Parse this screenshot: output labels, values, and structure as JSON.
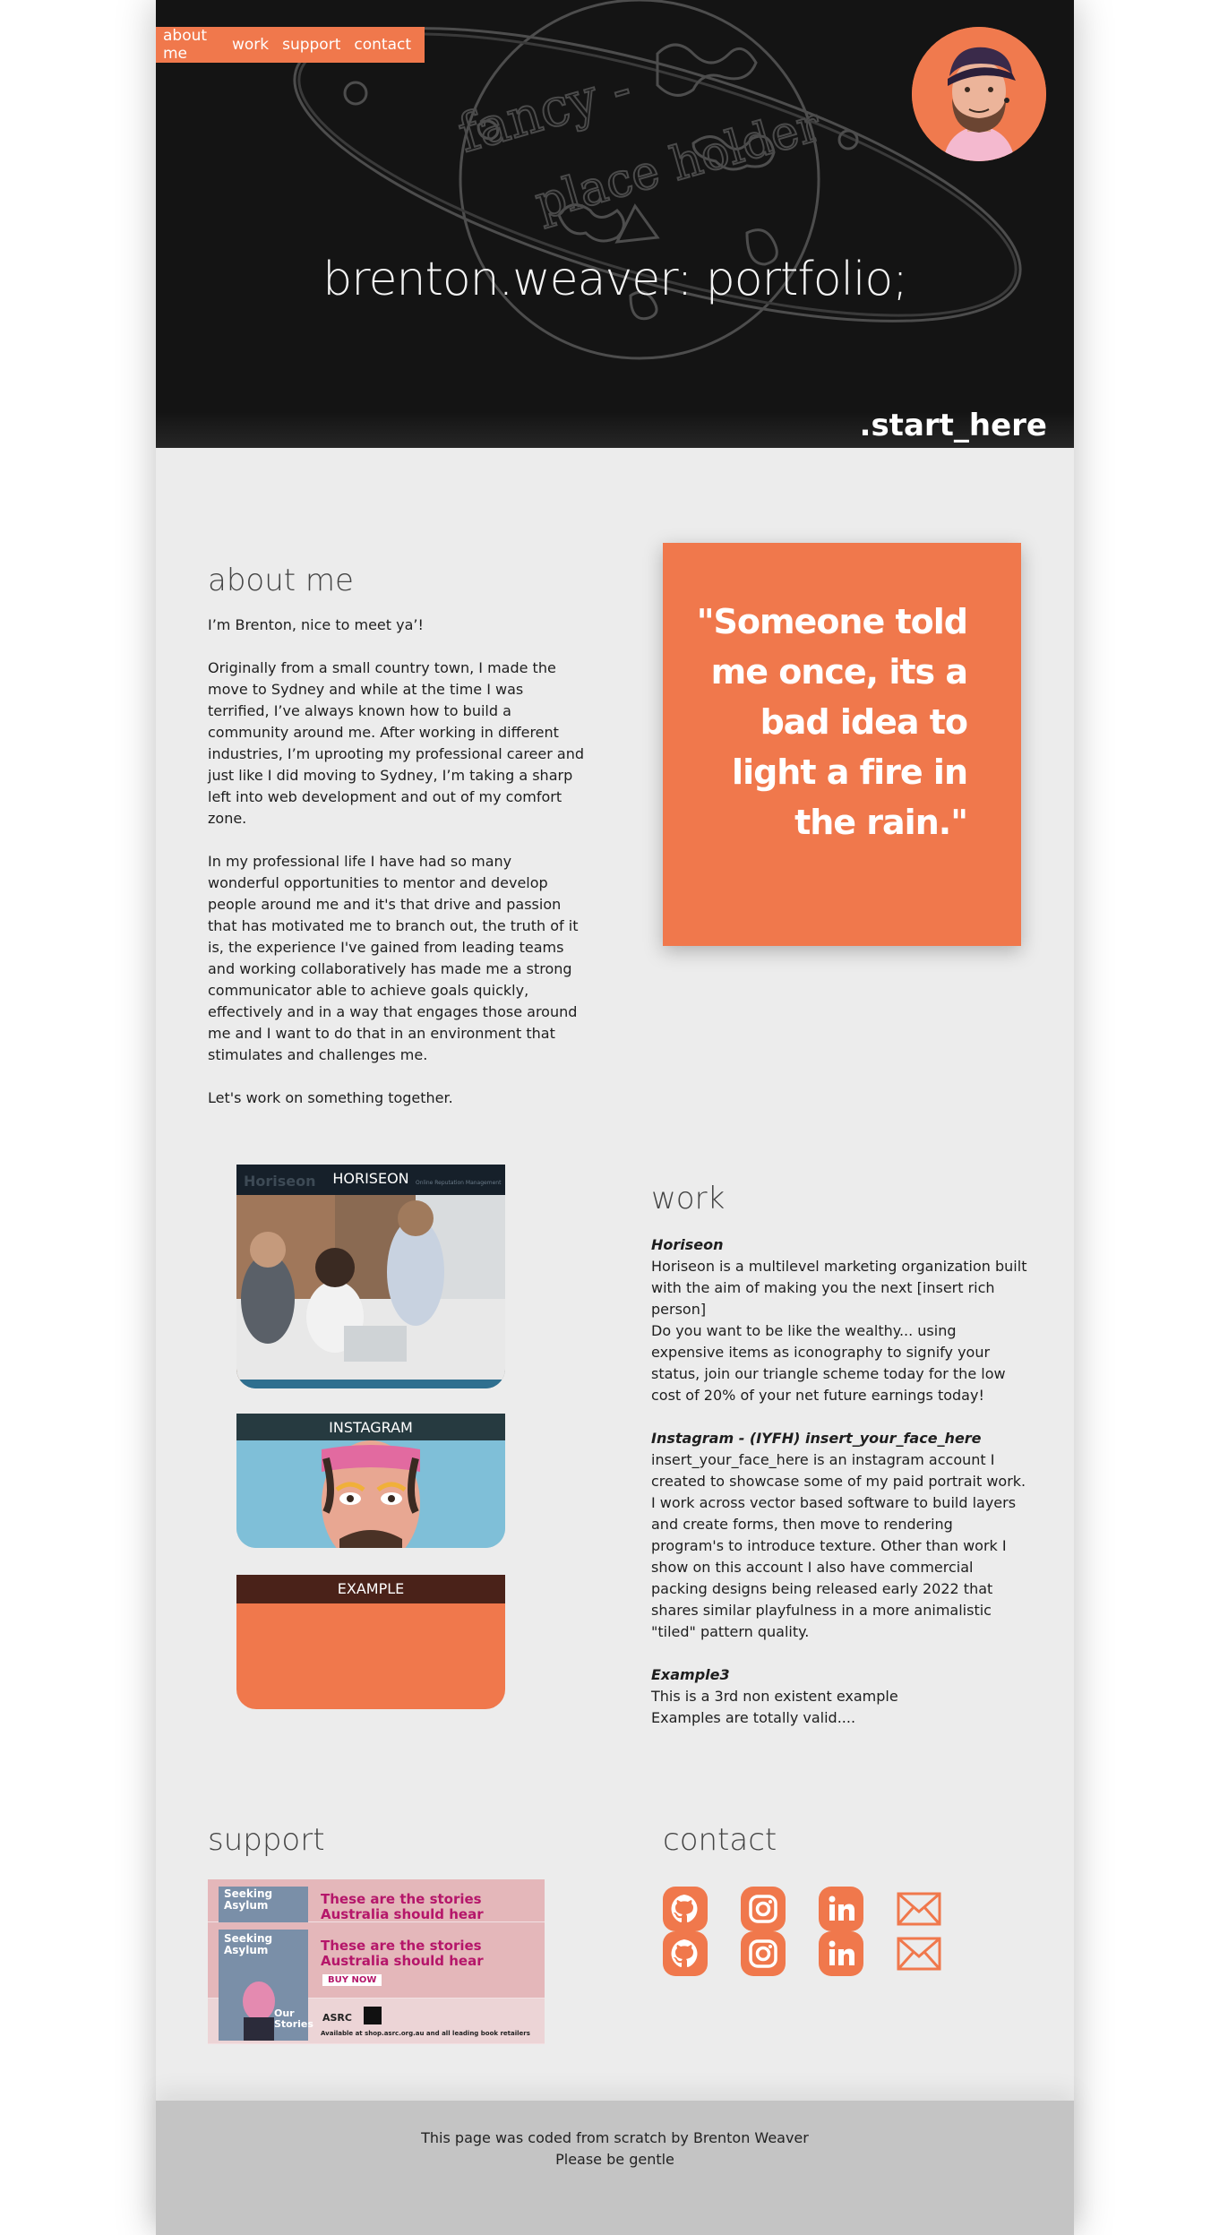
{
  "nav": {
    "items": [
      "about me",
      "work",
      "support",
      "contact"
    ]
  },
  "hero": {
    "title": "brenton.weaver: portfolio;",
    "sketch_text": [
      "fancy -",
      "place holder"
    ],
    "start_here": ".start_here"
  },
  "about": {
    "heading": "about me",
    "paragraphs": [
      "I’m Brenton, nice to meet ya’!",
      "Originally from a small country town, I made the move to Sydney and while at the time I was terrified, I’ve always known how to build a community around me. After working in different industries, I’m uprooting my professional career and just like I did moving to Sydney, I’m taking a sharp left into web development and out of my comfort zone.",
      "In my professional life I have had so many wonderful opportunities to mentor and develop people around me and it's that drive and passion that has motivated me to branch out, the truth of it is, the experience I've gained from leading teams and working collaboratively has made me a strong communicator able to achieve goals quickly, effectively and in a way that engages those around me and I want to do that in an environment that stimulates and challenges me.",
      "Let's work on something together."
    ],
    "quote": "\"Someone told me once, its a bad idea to light a fire in the rain.\""
  },
  "work": {
    "heading": "work",
    "cards": [
      {
        "label": "HORISEON",
        "logo": "Horiseon",
        "tagline": "Online Reputation Management",
        "band_color": "#16202a"
      },
      {
        "label": "INSTAGRAM",
        "band_color": "#263a40"
      },
      {
        "label": "EXAMPLE",
        "band_color": "#4a2219"
      }
    ],
    "projects": [
      {
        "title": "Horiseon",
        "lines": [
          "Horiseon is a multilevel marketing organization built with the aim of making you the next [insert rich person]",
          "Do you want to be like the wealthy... using expensive items as iconography to signify your status, join our triangle scheme today for the low cost of 20% of your net future earnings today!"
        ]
      },
      {
        "title": "Instagram - (IYFH) insert_your_face_here",
        "lines": [
          "insert_your_face_here is an instagram account I created to showcase some of my paid portrait work. I work across vector based software to build layers and create forms, then move to rendering program's to introduce texture. Other than work I show on this account I also have commercial packing designs being released early 2022 that shares similar playfulness in a more animalistic \"tiled\" pattern quality."
        ]
      },
      {
        "title": "Example3",
        "lines": [
          "This is a 3rd non existent example",
          "Examples are totally valid...."
        ]
      }
    ]
  },
  "support": {
    "heading": "support",
    "banner": {
      "book_title": "Seeking Asylum",
      "book_subtitle": "Our Stories",
      "headline": "These are the stories Australia should hear",
      "cta": "BUY NOW",
      "org": "ASRC",
      "availability": "Available at shop.asrc.org.au and all leading book retailers"
    }
  },
  "contact": {
    "heading": "contact",
    "icons": [
      "github-icon",
      "instagram-icon",
      "linkedin-icon",
      "email-icon"
    ],
    "accent": "#f0784c"
  },
  "footer": {
    "line1": "This page was coded from scratch by Brenton Weaver",
    "line2": "Please be gentle"
  },
  "colors": {
    "accent": "#f0784c",
    "page_bg": "#ececec",
    "hero_bg": "#141414",
    "footer_bg": "#c4c4c4"
  }
}
